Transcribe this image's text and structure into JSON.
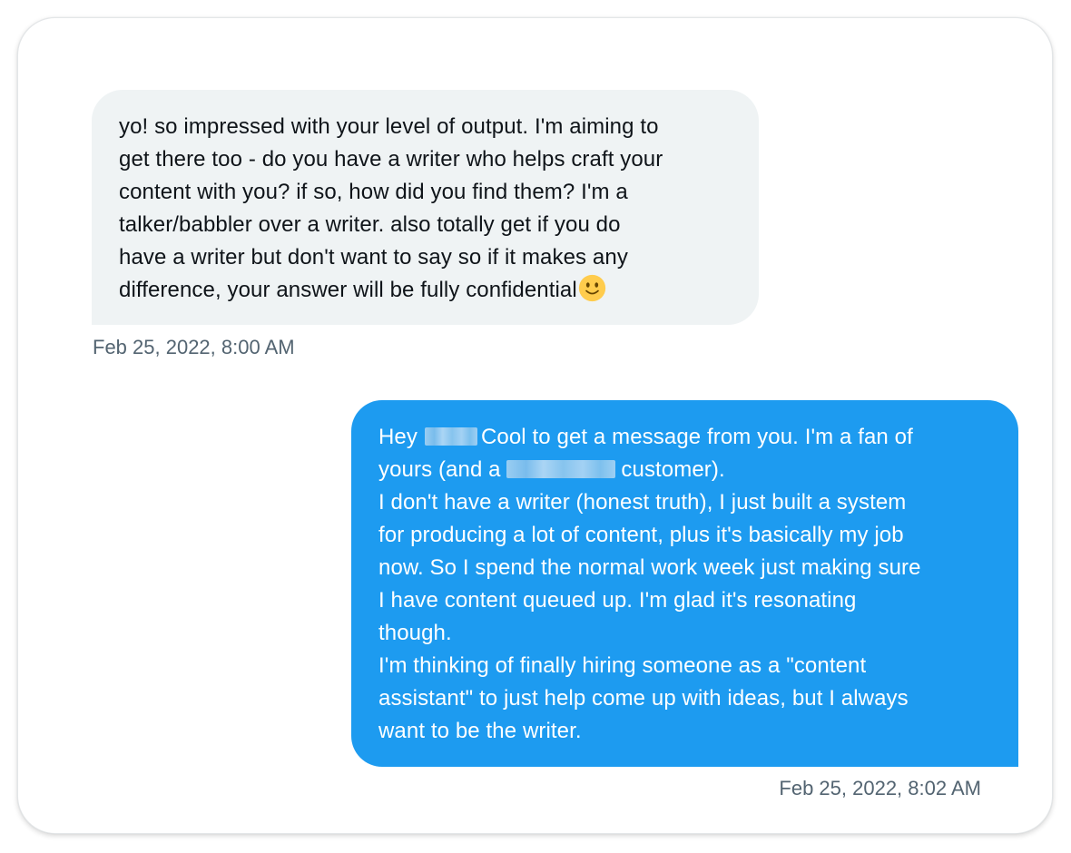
{
  "conversation": {
    "received": {
      "lines": [
        "yo! so impressed with your level of output. I'm aiming to",
        "get there too - do you have a writer who helps craft your",
        "content with you? if so, how did you find them? I'm a",
        "talker/babbler over a writer. also totally get if you do",
        "have a writer but don't want to say so if it makes any",
        "difference, your answer will be fully confidential"
      ],
      "emoji": "slightly-smiling-face-icon",
      "timestamp": "Feb 25, 2022, 8:00 AM"
    },
    "sent": {
      "line1_prefix": "Hey",
      "line1_suffix": "Cool to get a message from you. I'm a fan of",
      "line2_prefix": "yours (and a",
      "line2_suffix": "customer).",
      "lines": [
        "I don't have a writer (honest truth), I just built a system",
        "for producing a lot of content, plus it's basically my job",
        "now. So I spend the normal work week just making sure",
        "I have content queued up. I'm glad it's resonating",
        "though.",
        "I'm thinking of finally hiring someone as a \"content",
        "assistant\" to just help come up with ideas, but I always",
        "want to be the writer."
      ],
      "timestamp": "Feb 25, 2022, 8:02 AM"
    }
  },
  "colors": {
    "received_bubble": "#eff3f4",
    "sent_bubble": "#1d9bf0",
    "timestamp_text": "#536471",
    "emoji_face": "#ffcc4d"
  }
}
